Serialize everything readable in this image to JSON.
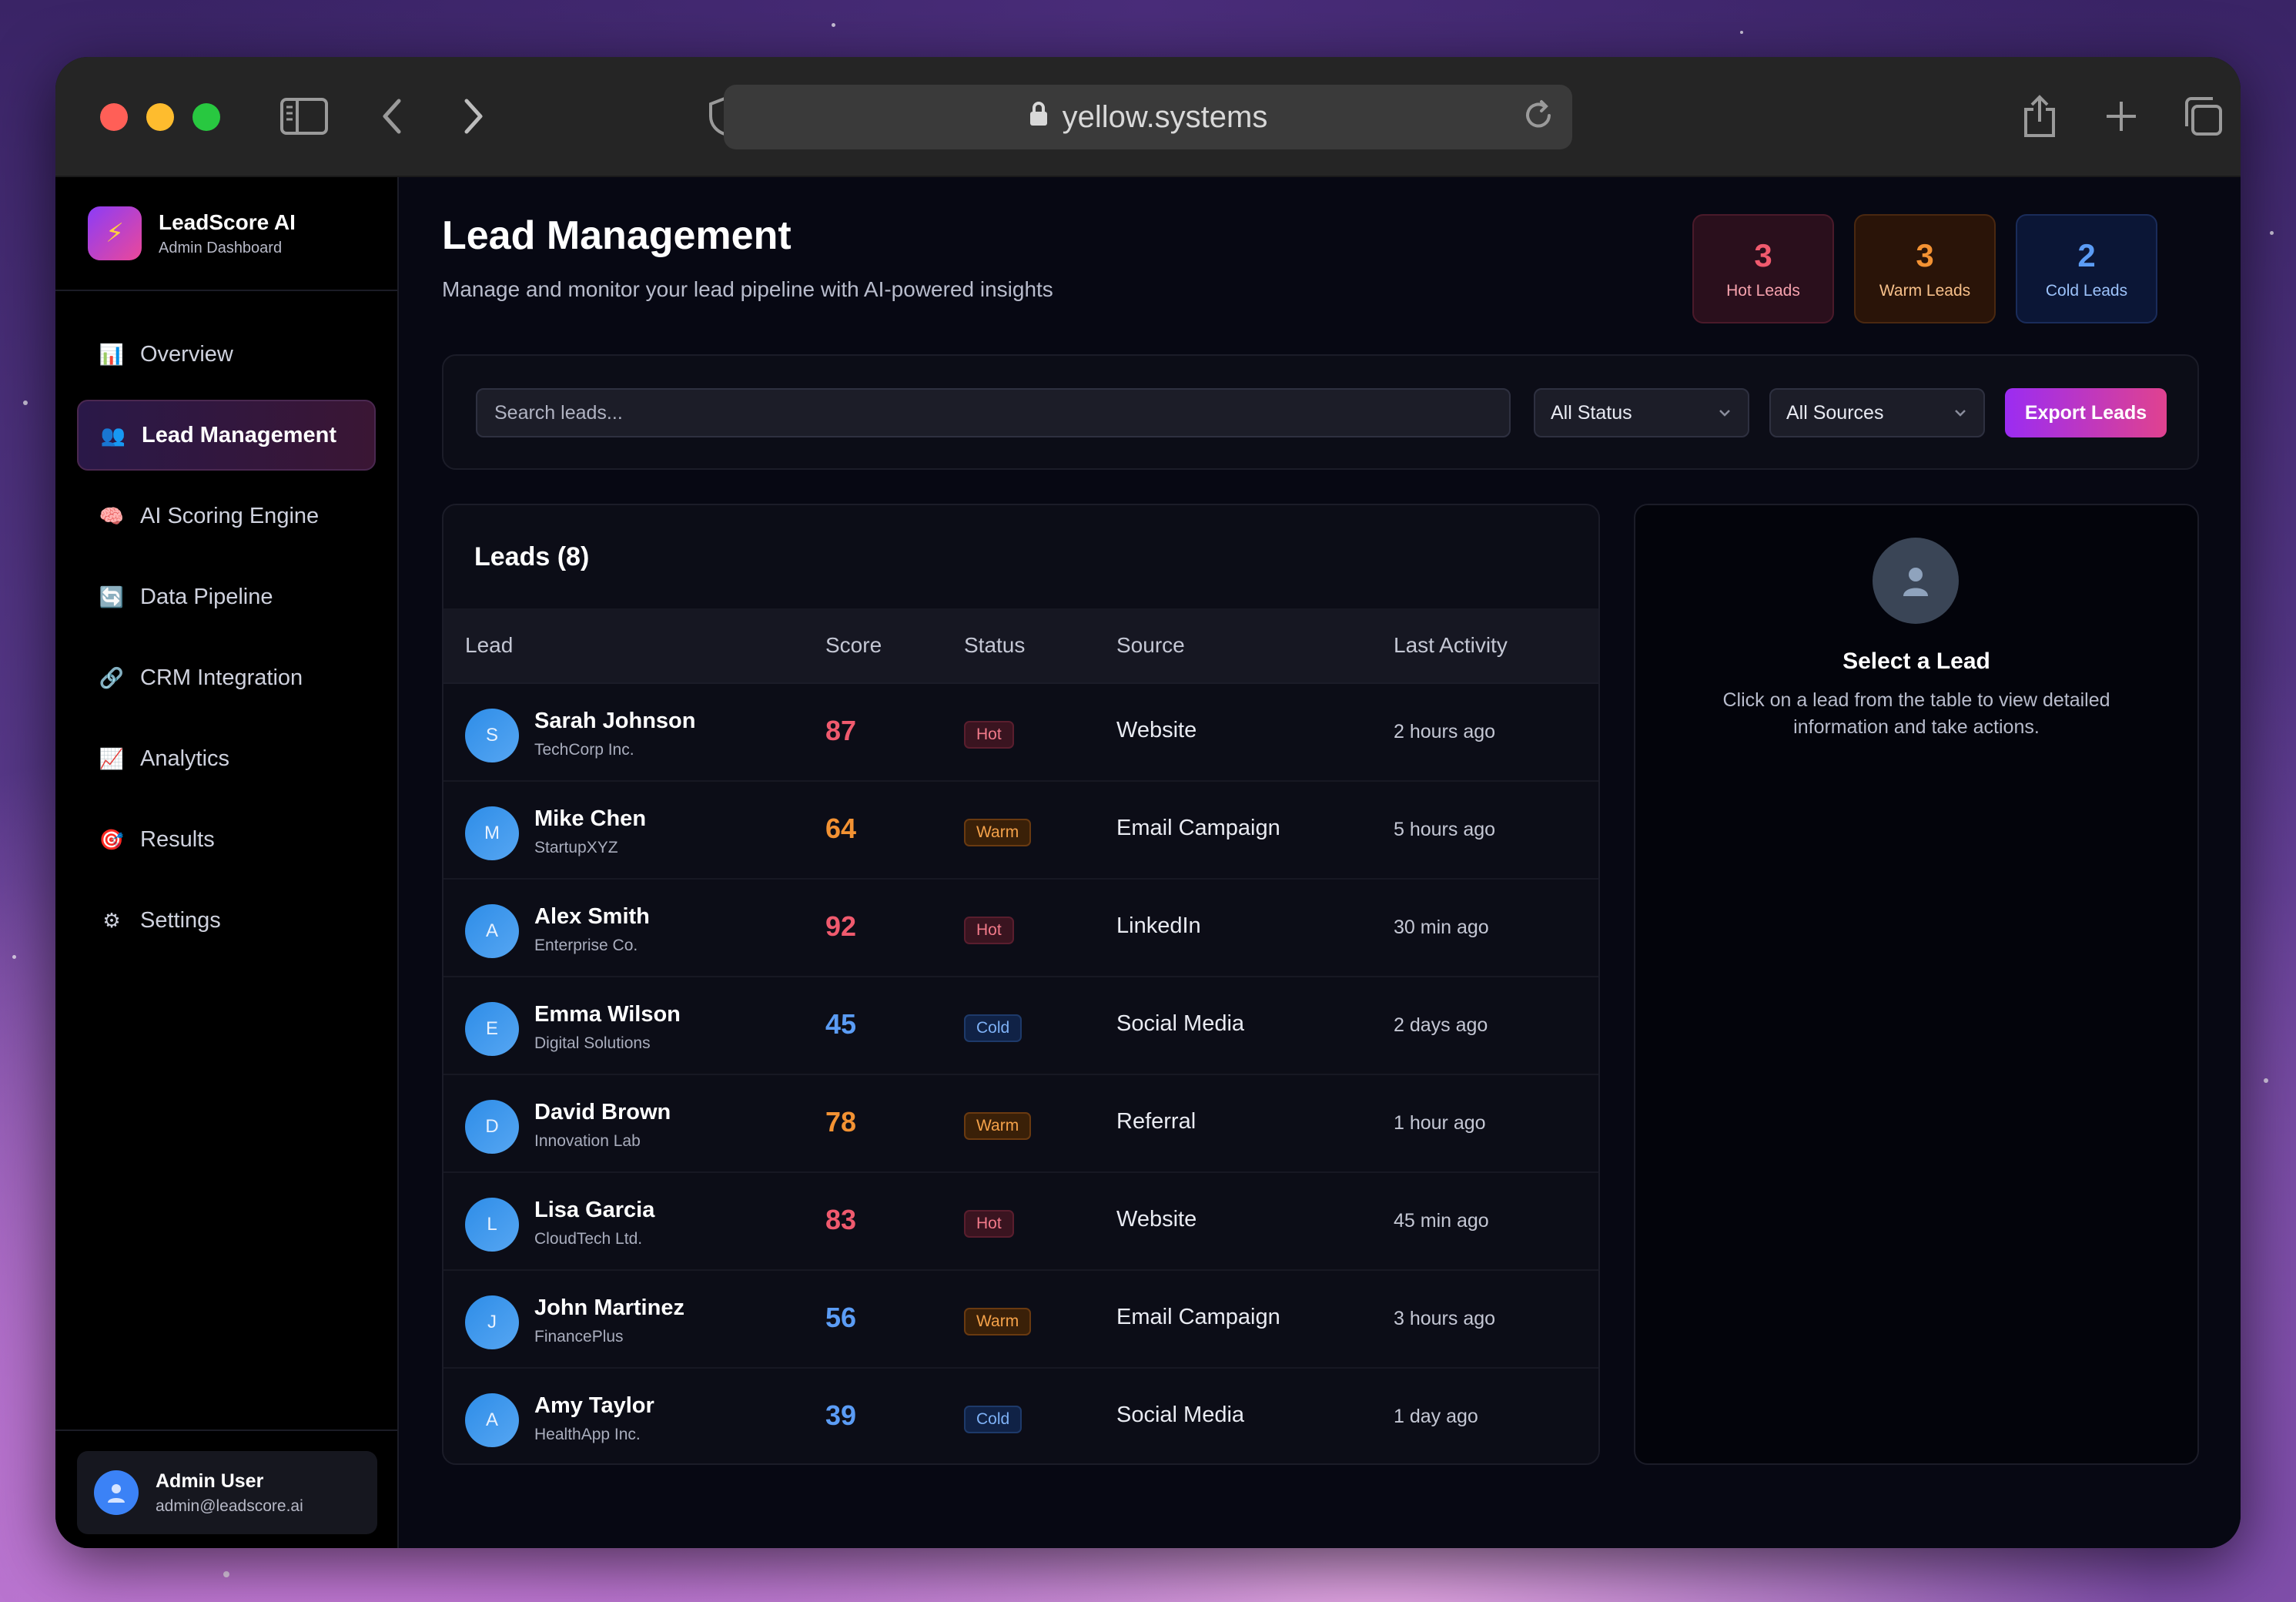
{
  "browser": {
    "url": "yellow.systems"
  },
  "brand": {
    "name": "LeadScore AI",
    "subtitle": "Admin Dashboard",
    "logo_icon": "⚡"
  },
  "sidebar": {
    "items": [
      {
        "label": "Overview",
        "icon": "📊"
      },
      {
        "label": "Lead Management",
        "icon": "👥"
      },
      {
        "label": "AI Scoring Engine",
        "icon": "🧠"
      },
      {
        "label": "Data Pipeline",
        "icon": "🔄"
      },
      {
        "label": "CRM Integration",
        "icon": "🔗"
      },
      {
        "label": "Analytics",
        "icon": "📈"
      },
      {
        "label": "Results",
        "icon": "🎯"
      },
      {
        "label": "Settings",
        "icon": "⚙"
      }
    ],
    "active_index": 1
  },
  "user": {
    "name": "Admin User",
    "email": "admin@leadscore.ai"
  },
  "page": {
    "title": "Lead Management",
    "subtitle": "Manage and monitor your lead pipeline with AI-powered insights"
  },
  "stats": {
    "hot": {
      "value": "3",
      "label": "Hot Leads"
    },
    "warm": {
      "value": "3",
      "label": "Warm Leads"
    },
    "cold": {
      "value": "2",
      "label": "Cold Leads"
    }
  },
  "filters": {
    "search_placeholder": "Search leads...",
    "status_selected": "All Status",
    "source_selected": "All Sources",
    "export_label": "Export Leads"
  },
  "leads": {
    "title": "Leads (8)",
    "columns": [
      "Lead",
      "Score",
      "Status",
      "Source",
      "Last Activity"
    ],
    "rows": [
      {
        "initial": "S",
        "name": "Sarah Johnson",
        "company": "TechCorp Inc.",
        "score": "87",
        "score_level": "hot",
        "status": "Hot",
        "source": "Website",
        "activity": "2 hours ago"
      },
      {
        "initial": "M",
        "name": "Mike Chen",
        "company": "StartupXYZ",
        "score": "64",
        "score_level": "warm",
        "status": "Warm",
        "source": "Email Campaign",
        "activity": "5 hours ago"
      },
      {
        "initial": "A",
        "name": "Alex Smith",
        "company": "Enterprise Co.",
        "score": "92",
        "score_level": "hot",
        "status": "Hot",
        "source": "LinkedIn",
        "activity": "30 min ago"
      },
      {
        "initial": "E",
        "name": "Emma Wilson",
        "company": "Digital Solutions",
        "score": "45",
        "score_level": "cold",
        "status": "Cold",
        "source": "Social Media",
        "activity": "2 days ago"
      },
      {
        "initial": "D",
        "name": "David Brown",
        "company": "Innovation Lab",
        "score": "78",
        "score_level": "warm",
        "status": "Warm",
        "source": "Referral",
        "activity": "1 hour ago"
      },
      {
        "initial": "L",
        "name": "Lisa Garcia",
        "company": "CloudTech Ltd.",
        "score": "83",
        "score_level": "hot",
        "status": "Hot",
        "source": "Website",
        "activity": "45 min ago"
      },
      {
        "initial": "J",
        "name": "John Martinez",
        "company": "FinancePlus",
        "score": "56",
        "score_level": "cold",
        "status": "Warm",
        "source": "Email Campaign",
        "activity": "3 hours ago"
      },
      {
        "initial": "A",
        "name": "Amy Taylor",
        "company": "HealthApp Inc.",
        "score": "39",
        "score_level": "cold",
        "status": "Cold",
        "source": "Social Media",
        "activity": "1 day ago"
      }
    ]
  },
  "detail": {
    "title": "Select a Lead",
    "text": "Click on a lead from the table to view detailed information and take actions."
  },
  "colors": {
    "hot": "#f05a6e",
    "warm": "#f39233",
    "cold": "#5b9cf5",
    "accent_start": "#9b2cf2",
    "accent_end": "#e0428f"
  }
}
